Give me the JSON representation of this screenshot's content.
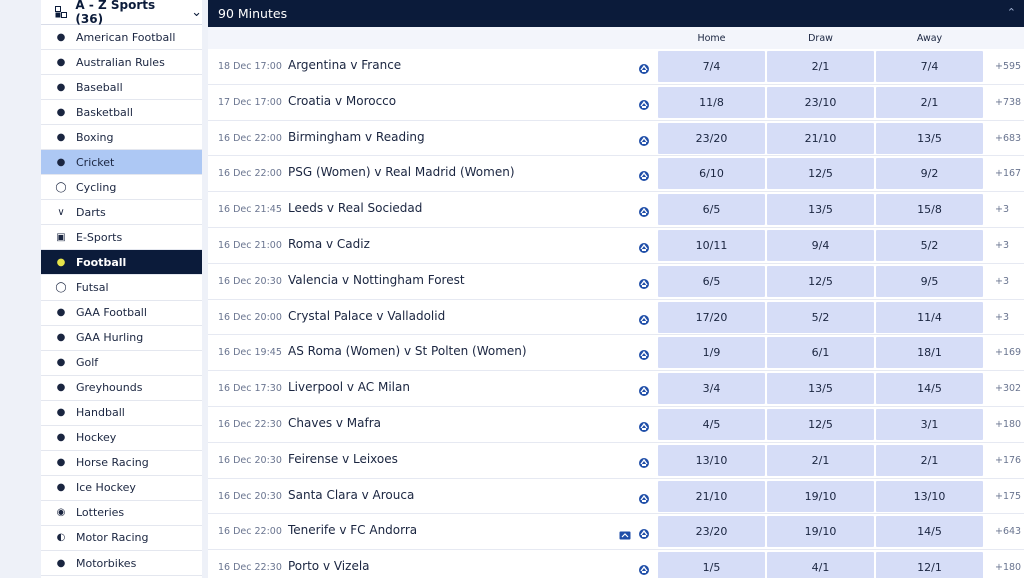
{
  "sidebar": {
    "title": "A - Z Sports (36)",
    "items": [
      {
        "label": "American Football",
        "icon": "american-football-icon",
        "state": ""
      },
      {
        "label": "Australian Rules",
        "icon": "australian-rules-icon",
        "state": ""
      },
      {
        "label": "Baseball",
        "icon": "baseball-icon",
        "state": ""
      },
      {
        "label": "Basketball",
        "icon": "basketball-icon",
        "state": ""
      },
      {
        "label": "Boxing",
        "icon": "boxing-icon",
        "state": ""
      },
      {
        "label": "Cricket",
        "icon": "cricket-icon",
        "state": "hover"
      },
      {
        "label": "Cycling",
        "icon": "cycling-icon",
        "state": ""
      },
      {
        "label": "Darts",
        "icon": "darts-icon",
        "state": ""
      },
      {
        "label": "E-Sports",
        "icon": "esports-icon",
        "state": ""
      },
      {
        "label": "Football",
        "icon": "football-icon",
        "state": "active"
      },
      {
        "label": "Futsal",
        "icon": "futsal-icon",
        "state": ""
      },
      {
        "label": "GAA Football",
        "icon": "gaa-football-icon",
        "state": ""
      },
      {
        "label": "GAA Hurling",
        "icon": "gaa-hurling-icon",
        "state": ""
      },
      {
        "label": "Golf",
        "icon": "golf-icon",
        "state": ""
      },
      {
        "label": "Greyhounds",
        "icon": "greyhounds-icon",
        "state": ""
      },
      {
        "label": "Handball",
        "icon": "handball-icon",
        "state": ""
      },
      {
        "label": "Hockey",
        "icon": "hockey-icon",
        "state": ""
      },
      {
        "label": "Horse Racing",
        "icon": "horse-racing-icon",
        "state": ""
      },
      {
        "label": "Ice Hockey",
        "icon": "ice-hockey-icon",
        "state": ""
      },
      {
        "label": "Lotteries",
        "icon": "lotteries-icon",
        "state": ""
      },
      {
        "label": "Motor Racing",
        "icon": "motor-racing-icon",
        "state": ""
      },
      {
        "label": "Motorbikes",
        "icon": "motorbikes-icon",
        "state": ""
      }
    ]
  },
  "market": {
    "title": "90 Minutes",
    "columns": {
      "home": "Home",
      "draw": "Draw",
      "away": "Away"
    }
  },
  "events": [
    {
      "date": "18 Dec 17:00",
      "name": "Argentina v France",
      "home": "7/4",
      "draw": "2/1",
      "away": "7/4",
      "more": "+595",
      "tv": false
    },
    {
      "date": "17 Dec 17:00",
      "name": "Croatia v Morocco",
      "home": "11/8",
      "draw": "23/10",
      "away": "2/1",
      "more": "+738",
      "tv": false
    },
    {
      "date": "16 Dec 22:00",
      "name": "Birmingham v Reading",
      "home": "23/20",
      "draw": "21/10",
      "away": "13/5",
      "more": "+683",
      "tv": false
    },
    {
      "date": "16 Dec 22:00",
      "name": "PSG (Women) v Real Madrid (Women)",
      "home": "6/10",
      "draw": "12/5",
      "away": "9/2",
      "more": "+167",
      "tv": false
    },
    {
      "date": "16 Dec 21:45",
      "name": "Leeds v Real Sociedad",
      "home": "6/5",
      "draw": "13/5",
      "away": "15/8",
      "more": "+3",
      "tv": false
    },
    {
      "date": "16 Dec 21:00",
      "name": "Roma v Cadiz",
      "home": "10/11",
      "draw": "9/4",
      "away": "5/2",
      "more": "+3",
      "tv": false
    },
    {
      "date": "16 Dec 20:30",
      "name": "Valencia v Nottingham Forest",
      "home": "6/5",
      "draw": "12/5",
      "away": "9/5",
      "more": "+3",
      "tv": false
    },
    {
      "date": "16 Dec 20:00",
      "name": "Crystal Palace v Valladolid",
      "home": "17/20",
      "draw": "5/2",
      "away": "11/4",
      "more": "+3",
      "tv": false
    },
    {
      "date": "16 Dec 19:45",
      "name": "AS Roma (Women) v St Polten (Women)",
      "home": "1/9",
      "draw": "6/1",
      "away": "18/1",
      "more": "+169",
      "tv": false
    },
    {
      "date": "16 Dec 17:30",
      "name": "Liverpool v AC Milan",
      "home": "3/4",
      "draw": "13/5",
      "away": "14/5",
      "more": "+302",
      "tv": false
    },
    {
      "date": "16 Dec 22:30",
      "name": "Chaves v Mafra",
      "home": "4/5",
      "draw": "12/5",
      "away": "3/1",
      "more": "+180",
      "tv": false
    },
    {
      "date": "16 Dec 20:30",
      "name": "Feirense v Leixoes",
      "home": "13/10",
      "draw": "2/1",
      "away": "2/1",
      "more": "+176",
      "tv": false
    },
    {
      "date": "16 Dec 20:30",
      "name": "Santa Clara v Arouca",
      "home": "21/10",
      "draw": "19/10",
      "away": "13/10",
      "more": "+175",
      "tv": false
    },
    {
      "date": "16 Dec 22:00",
      "name": "Tenerife v FC Andorra",
      "home": "23/20",
      "draw": "19/10",
      "away": "14/5",
      "more": "+643",
      "tv": true
    },
    {
      "date": "16 Dec 22:30",
      "name": "Porto v Vizela",
      "home": "1/5",
      "draw": "4/1",
      "away": "12/1",
      "more": "+180",
      "tv": false
    }
  ],
  "colors": {
    "navy": "#0b1b3a",
    "odds_bg": "#d6ddf7",
    "hover": "#adc8f4",
    "football_icon": "#e6e34a"
  }
}
